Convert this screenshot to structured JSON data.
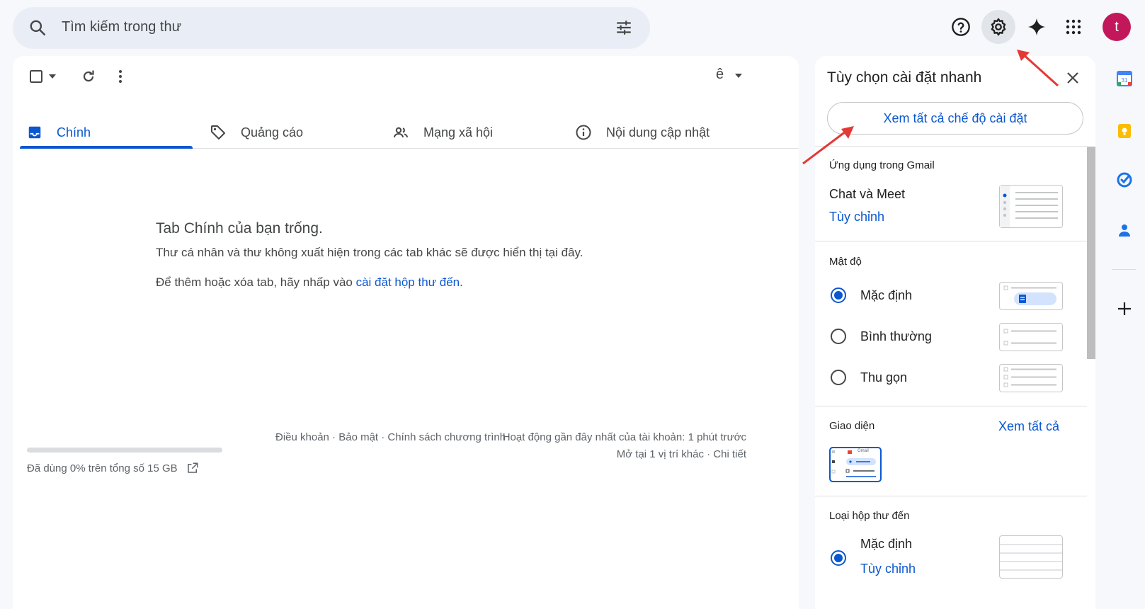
{
  "search": {
    "placeholder": "Tìm kiếm trong thư"
  },
  "user": {
    "avatar_letter": "t",
    "avatar_color": "#c2185b"
  },
  "toolbar": {
    "input_tool": "ê"
  },
  "tabs": [
    {
      "label": "Chính",
      "active": true
    },
    {
      "label": "Quảng cáo",
      "active": false
    },
    {
      "label": "Mạng xã hội",
      "active": false
    },
    {
      "label": "Nội dung cập nhật",
      "active": false
    }
  ],
  "empty": {
    "title": "Tab Chính của bạn trống.",
    "line1": "Thư cá nhân và thư không xuất hiện trong các tab khác sẽ được hiển thị tại đây.",
    "line2_prefix": "Để thêm hoặc xóa tab, hãy nhấp vào ",
    "line2_link": "cài đặt hộp thư đến",
    "line2_suffix": "."
  },
  "footer": {
    "storage_fraction": 0.0,
    "storage": "Đã dùng 0% trên tổng số 15 GB",
    "links": "Điều khoản · Bảo mật · Chính sách chương trình",
    "activity": "Hoạt động gần đây nhất của tài khoản: 1 phút trước",
    "details": "Mở tại 1 vị trí khác · Chi tiết"
  },
  "settings": {
    "title": "Tùy chọn cài đặt nhanh",
    "see_all_settings": "Xem tất cả chế độ cài đặt",
    "apps_title": "Ứng dụng trong Gmail",
    "chat_meet": "Chat và Meet",
    "customize": "Tùy chỉnh",
    "density_title": "Mật độ",
    "density_options": [
      {
        "label": "Mặc định",
        "selected": true
      },
      {
        "label": "Bình thường",
        "selected": false
      },
      {
        "label": "Thu gọn",
        "selected": false
      }
    ],
    "theme_title": "Giao diện",
    "theme_see_all": "Xem tất cả",
    "theme_thumb_text": "Gmail",
    "inbox_type_title": "Loại hộp thư đến",
    "inbox_default": "Mặc định",
    "inbox_customize": "Tùy chỉnh"
  },
  "colors": {
    "accent": "#0b57d0",
    "annotation_arrow": "#e53935"
  }
}
